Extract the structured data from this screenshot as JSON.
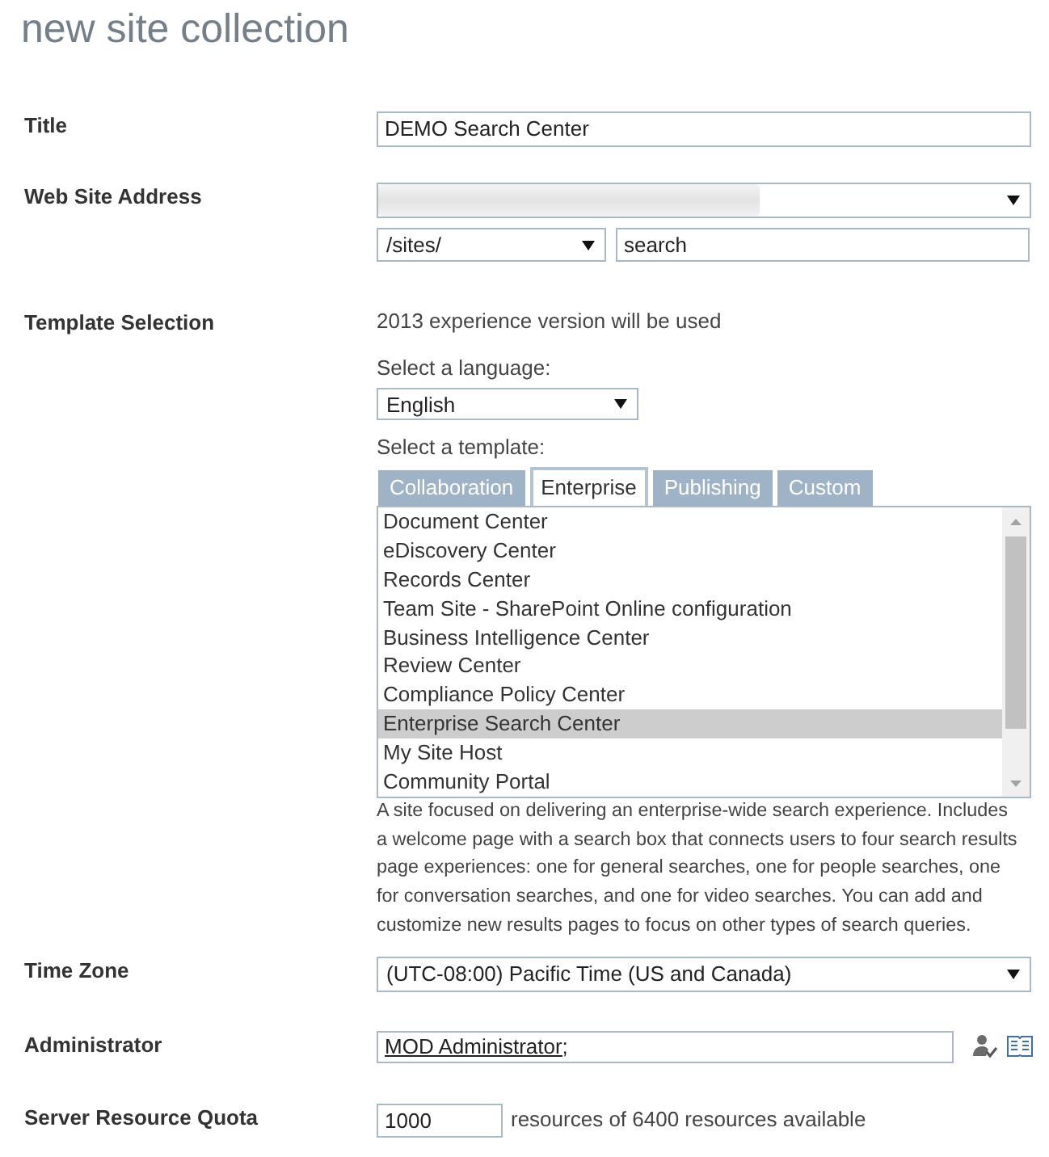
{
  "page_title": "new site collection",
  "sections": [
    {
      "kind": "text",
      "label": "Title",
      "value": "DEMO Search Center"
    },
    {
      "kind": "address",
      "label": "Web Site Address",
      "domain": {
        "redacted": true
      },
      "path": "/sites/",
      "name": "search"
    },
    {
      "kind": "template",
      "label": "Template Selection",
      "note": "2013 experience version will be used",
      "language_prompt": "Select a language:",
      "language": "English",
      "template_prompt": "Select a template:",
      "tabs": [
        {
          "label": "Collaboration",
          "selected": false
        },
        {
          "label": "Enterprise",
          "selected": true
        },
        {
          "label": "Publishing",
          "selected": false
        },
        {
          "label": "Custom",
          "selected": false
        }
      ],
      "templates": [
        {
          "label": "Document Center",
          "selected": false
        },
        {
          "label": "eDiscovery Center",
          "selected": false
        },
        {
          "label": "Records Center",
          "selected": false
        },
        {
          "label": "Team Site - SharePoint Online configuration",
          "selected": false
        },
        {
          "label": "Business Intelligence Center",
          "selected": false
        },
        {
          "label": "Review Center",
          "selected": false
        },
        {
          "label": "Compliance Policy Center",
          "selected": false
        },
        {
          "label": "Enterprise Search Center",
          "selected": true
        },
        {
          "label": "My Site Host",
          "selected": false
        },
        {
          "label": "Community Portal",
          "selected": false
        }
      ],
      "description": "A site focused on delivering an enterprise-wide search experience. Includes a welcome page with a search box that connects users to four search results page experiences: one for general searches, one for people searches, one for conversation searches, and one for video searches. You can add and customize new results pages to focus on other types of search queries."
    },
    {
      "kind": "select",
      "label": "Time Zone",
      "value": "(UTC-08:00) Pacific Time (US and Canada)"
    },
    {
      "kind": "people",
      "label": "Administrator",
      "value": "MOD Administrator;"
    },
    {
      "kind": "quota",
      "label": "Server Resource Quota",
      "value": "1000",
      "note": "resources of 6400 resources available"
    }
  ]
}
